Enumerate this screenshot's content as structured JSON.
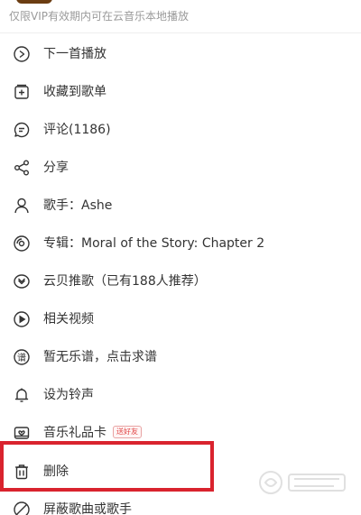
{
  "header": {
    "vip_notice": "仅限VIP有效期内可在云音乐本地播放"
  },
  "menu": {
    "items": [
      {
        "label": "下一首播放",
        "icon": "play-next-icon"
      },
      {
        "label": "收藏到歌单",
        "icon": "add-to-playlist-icon"
      },
      {
        "label": "评论(1186)",
        "icon": "comment-icon"
      },
      {
        "label": "分享",
        "icon": "share-icon"
      },
      {
        "label": "歌手：Ashe",
        "icon": "singer-icon"
      },
      {
        "label": "专辑：Moral of the Story: Chapter 2",
        "icon": "album-icon"
      },
      {
        "label": "云贝推歌（已有188人推荐）",
        "icon": "recommend-icon"
      },
      {
        "label": "相关视频",
        "icon": "video-icon"
      },
      {
        "label": "暂无乐谱，点击求谱",
        "icon": "sheet-music-icon"
      },
      {
        "label": "设为铃声",
        "icon": "bell-icon"
      },
      {
        "label": "音乐礼品卡",
        "icon": "gift-card-icon",
        "badge": "送好友"
      },
      {
        "label": "删除",
        "icon": "trash-icon"
      },
      {
        "label": "屏蔽歌曲或歌手",
        "icon": "block-icon"
      }
    ]
  },
  "colors": {
    "highlight": "#d9232e",
    "text": "#333333",
    "muted": "#9a9a9a"
  }
}
